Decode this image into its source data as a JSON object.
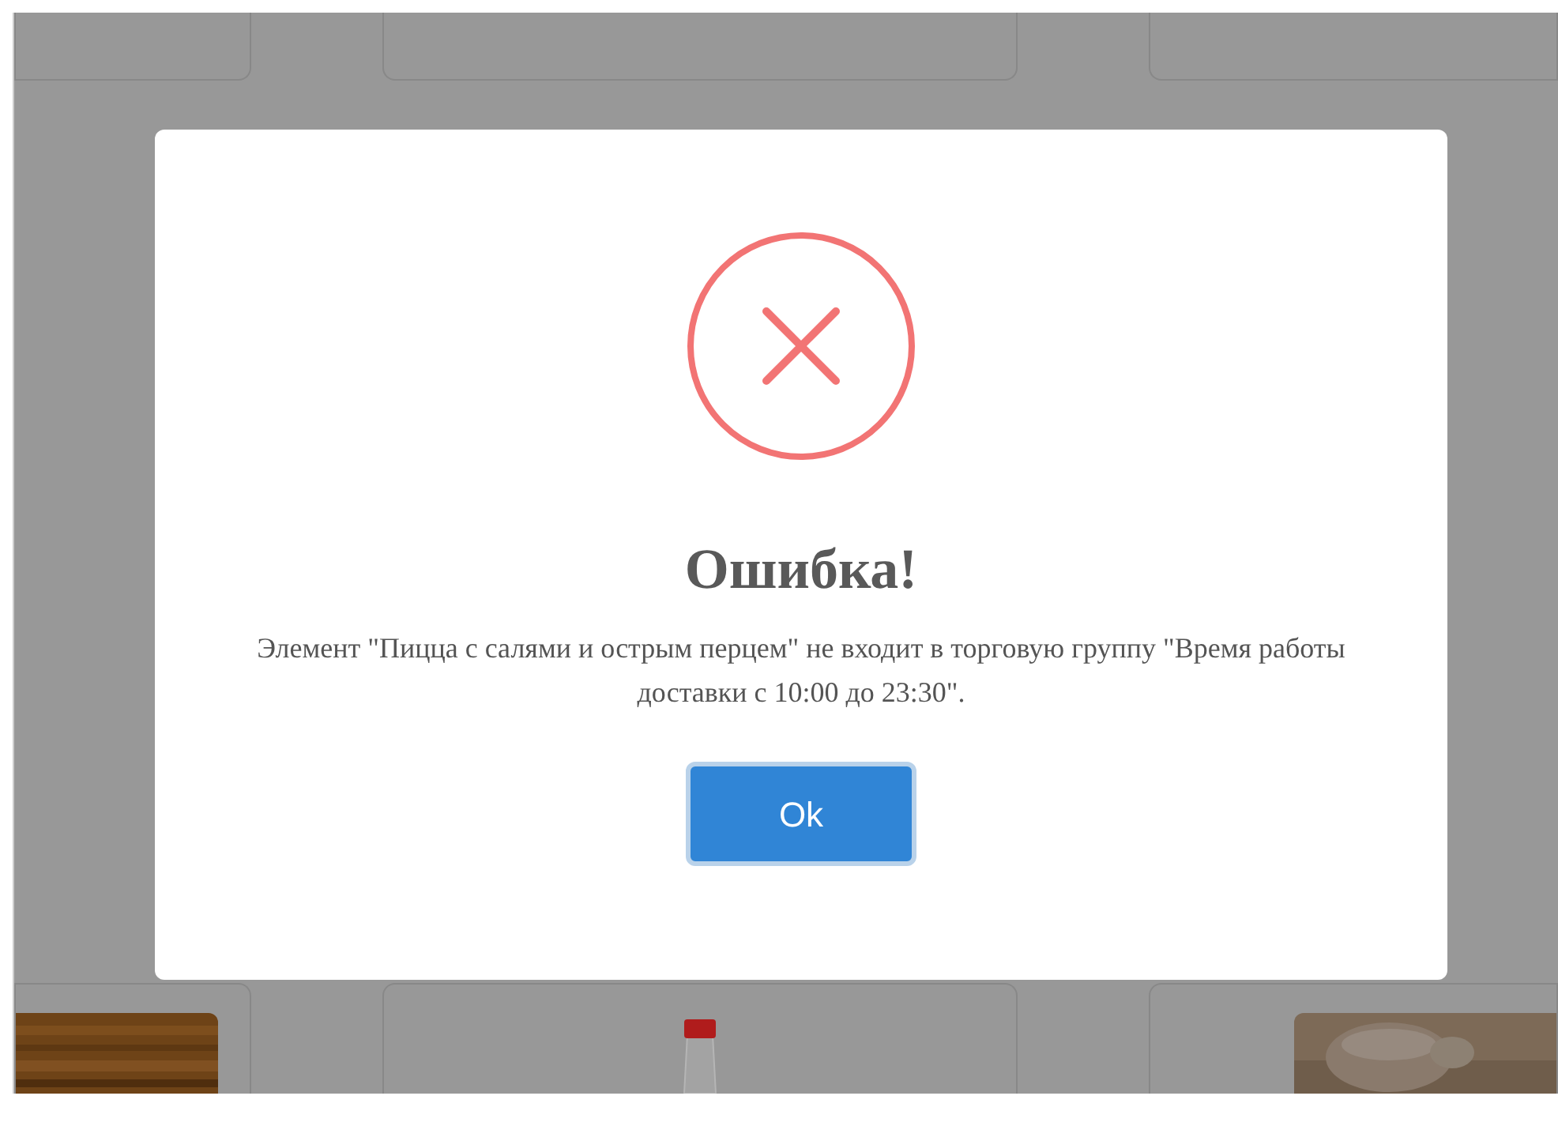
{
  "products_top": [
    {
      "kind": "empty"
    },
    {
      "kind": "empty"
    },
    {
      "kind": "empty"
    }
  ],
  "products_bottom": [
    {
      "kind": "picture"
    },
    {
      "kind": "bottle"
    },
    {
      "kind": "picture"
    }
  ],
  "dialog": {
    "title": "Ошибка!",
    "message": "Элемент \"Пицца с салями и острым перцем\" не входит в торговую группу \"Время работы доставки с 10:00 до 23:30\".",
    "button": "Ok"
  }
}
